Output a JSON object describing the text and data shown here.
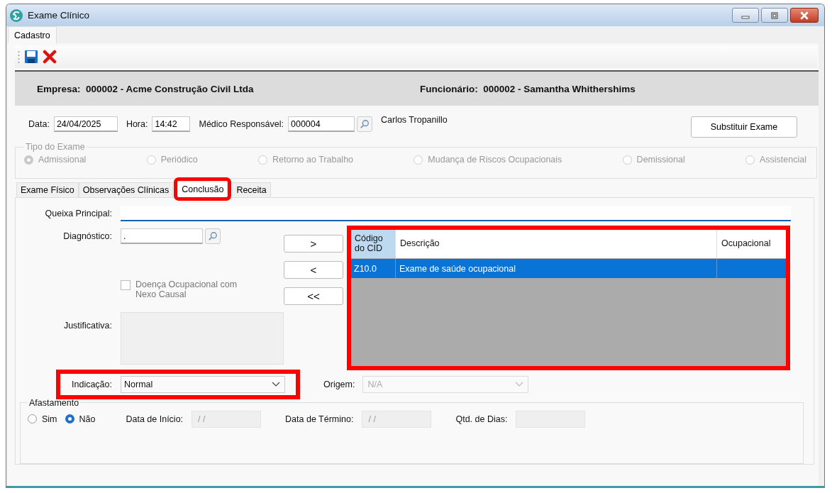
{
  "window": {
    "title": "Exame Clínico"
  },
  "menu_tabs": [
    {
      "label": "Cadastro"
    }
  ],
  "header": {
    "empresa_label": "Empresa:",
    "empresa": "000002 - Acme Construção Civil Ltda",
    "funcionario_label": "Funcionário:",
    "funcionario": "000002 - Samantha Whithershims"
  },
  "data": {
    "label": "Data:",
    "value": "24/04/2025"
  },
  "hora": {
    "label": "Hora:",
    "value": "14:42"
  },
  "medico": {
    "label": "Médico Responsável:",
    "value": "000004",
    "name": "Carlos Tropanillo"
  },
  "substituir_button": "Substituir Exame",
  "tipo_exame": {
    "title": "Tipo do Exame",
    "disabled": true,
    "options": [
      {
        "label": "Admissional",
        "selected": true
      },
      {
        "label": "Periódico",
        "selected": false
      },
      {
        "label": "Retorno ao Trabalho",
        "selected": false
      },
      {
        "label": "Mudança de Riscos Ocupacionais",
        "selected": false
      },
      {
        "label": "Demissional",
        "selected": false
      },
      {
        "label": "Assistencial",
        "selected": false
      }
    ]
  },
  "tabs": [
    {
      "label": "Exame Físico",
      "selected": false,
      "highlighted": false
    },
    {
      "label": "Observações Clínicas",
      "selected": false,
      "highlighted": false
    },
    {
      "label": "Conclusão",
      "selected": true,
      "highlighted": true
    },
    {
      "label": "Receita",
      "selected": false,
      "highlighted": false
    }
  ],
  "queixa": {
    "label": "Queixa Principal:"
  },
  "diagnostico": {
    "label": "Diagnóstico:",
    "value": "."
  },
  "move_buttons": [
    ">",
    "<",
    "<<"
  ],
  "doenca_checkbox": {
    "label": "Doença Ocupacional com Nexo Causal",
    "checked": false,
    "disabled": true
  },
  "justificativa": {
    "label": "Justificativa:"
  },
  "cid_table": {
    "highlighted": true,
    "columns": [
      "Código do CID",
      "Descrição",
      "Ocupacional"
    ],
    "rows": [
      {
        "cells": [
          "Z10.0",
          "Exame de saúde ocupacional",
          ""
        ],
        "selected": true
      }
    ]
  },
  "indicacao": {
    "label": "Indicação:",
    "value": "Normal",
    "highlighted": true
  },
  "origem": {
    "label": "Origem:",
    "value": "N/A",
    "disabled": true
  },
  "afastamento": {
    "title": "Afastamento",
    "options": [
      {
        "label": "Sim",
        "selected": false
      },
      {
        "label": "Não",
        "selected": true
      }
    ],
    "inicio": {
      "label": "Data de Início:",
      "placeholder": "/ /"
    },
    "termino": {
      "label": "Data de Término:",
      "placeholder": "/ /"
    },
    "dias": {
      "label": "Qtd. de Dias:"
    }
  }
}
